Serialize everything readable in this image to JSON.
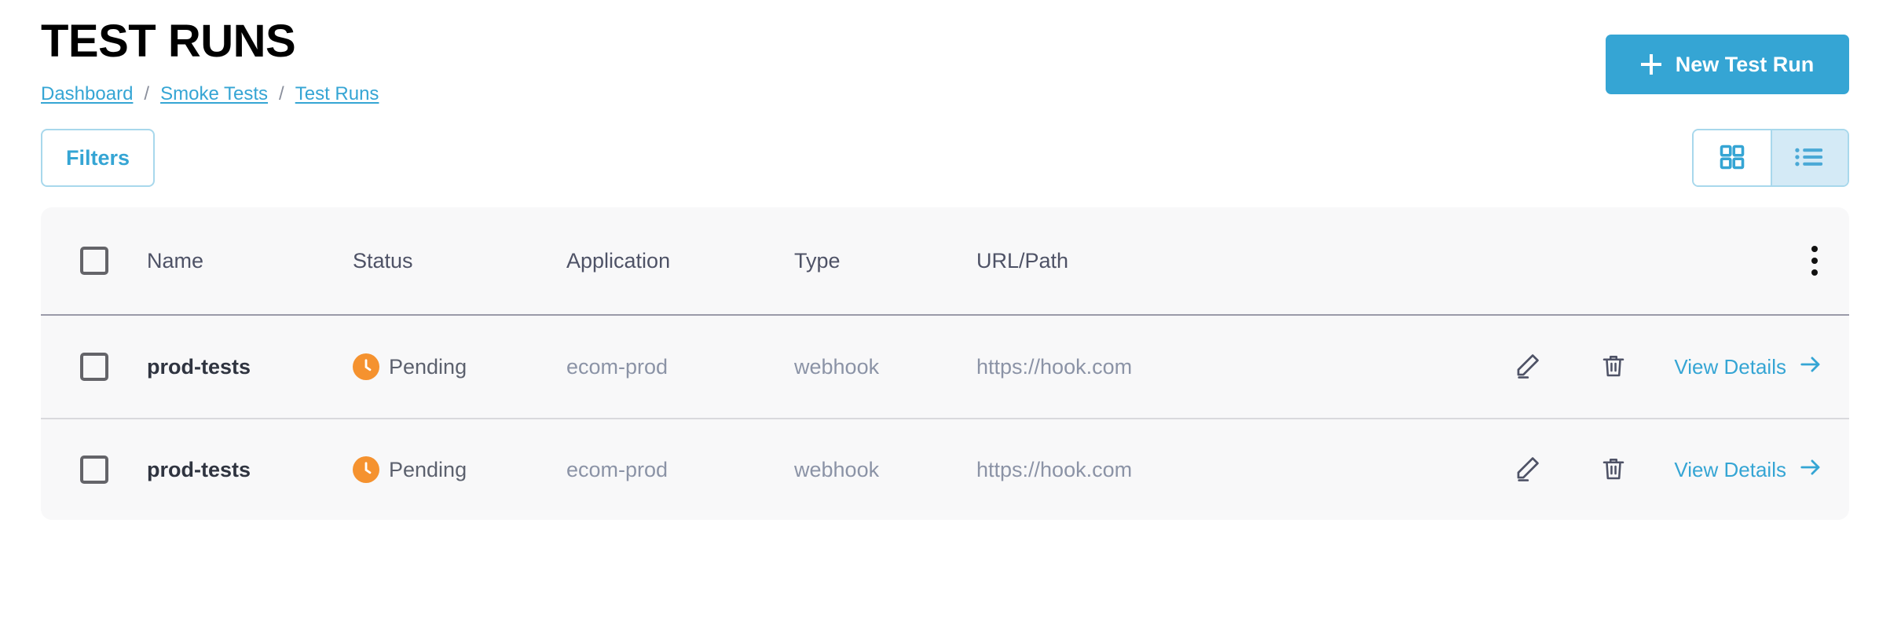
{
  "header": {
    "title": "TEST RUNS",
    "breadcrumb": [
      {
        "label": "Dashboard"
      },
      {
        "label": "Smoke Tests"
      },
      {
        "label": "Test Runs"
      }
    ],
    "separator": "/",
    "new_button": "New Test Run"
  },
  "toolbar": {
    "filters_label": "Filters",
    "grid_view_icon": "grid-view-icon",
    "list_view_icon": "list-view-icon",
    "active_view": "list"
  },
  "table": {
    "columns": [
      "Name",
      "Status",
      "Application",
      "Type",
      "URL/Path"
    ],
    "row_menu_icon": "more-vertical-icon",
    "rows": [
      {
        "name": "prod-tests",
        "status": "Pending",
        "status_icon": "clock-icon",
        "application": "ecom-prod",
        "type": "webhook",
        "url": "https://hook.com",
        "edit_icon": "pencil-icon",
        "delete_icon": "trash-icon",
        "details_label": "View Details"
      },
      {
        "name": "prod-tests",
        "status": "Pending",
        "status_icon": "clock-icon",
        "application": "ecom-prod",
        "type": "webhook",
        "url": "https://hook.com",
        "edit_icon": "pencil-icon",
        "delete_icon": "trash-icon",
        "details_label": "View Details"
      }
    ]
  },
  "colors": {
    "accent": "#35a5d4",
    "accent_soft": "#d4eaf6",
    "accent_border": "#a8d8ec",
    "status_pending": "#f5922f",
    "table_bg": "#f8f8f9",
    "text_muted": "#8b93a6"
  }
}
